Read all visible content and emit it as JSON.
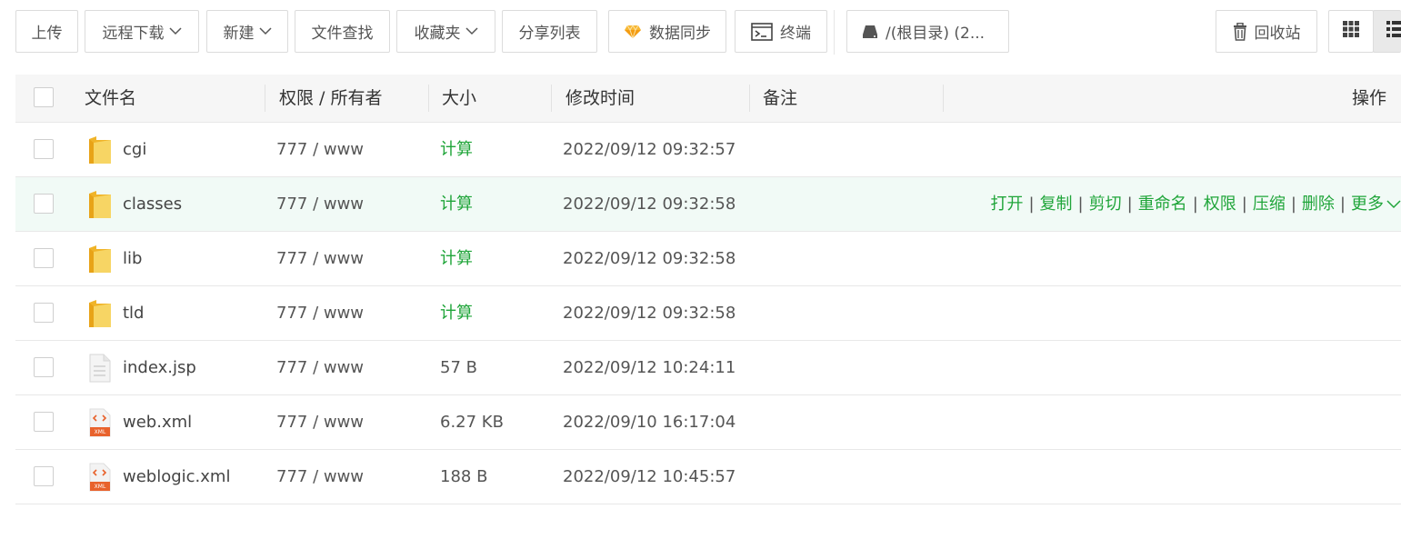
{
  "toolbar": {
    "upload": "上传",
    "remote_download": "远程下载",
    "new": "新建",
    "file_search": "文件查找",
    "favorites": "收藏夹",
    "share_list": "分享列表",
    "data_sync": "数据同步",
    "terminal": "终端",
    "path": "/(根目录) (2...",
    "recycle_bin": "回收站"
  },
  "table": {
    "headers": {
      "name": "文件名",
      "perm": "权限 / 所有者",
      "size": "大小",
      "mtime": "修改时间",
      "remark": "备注",
      "ops": "操作"
    },
    "rows": [
      {
        "name": "cgi",
        "type": "folder-icon",
        "perm": "777 / www",
        "size": "计算",
        "mtime": "2022/09/12 09:32:57"
      },
      {
        "name": "classes",
        "type": "folder-icon",
        "perm": "777 / www",
        "size": "计算",
        "mtime": "2022/09/12 09:32:58"
      },
      {
        "name": "lib",
        "type": "folder-icon",
        "perm": "777 / www",
        "size": "计算",
        "mtime": "2022/09/12 09:32:58"
      },
      {
        "name": "tld",
        "type": "folder-icon",
        "perm": "777 / www",
        "size": "计算",
        "mtime": "2022/09/12 09:32:58"
      },
      {
        "name": "index.jsp",
        "type": "text-file-icon",
        "perm": "777 / www",
        "size": "57 B",
        "mtime": "2022/09/12 10:24:11"
      },
      {
        "name": "web.xml",
        "type": "xml-file-icon",
        "perm": "777 / www",
        "size": "6.27 KB",
        "mtime": "2022/09/10 16:17:04"
      },
      {
        "name": "weblogic.xml",
        "type": "xml-file-icon",
        "perm": "777 / www",
        "size": "188 B",
        "mtime": "2022/09/12 10:45:57"
      }
    ],
    "row_actions": {
      "open": "打开",
      "copy": "复制",
      "cut": "剪切",
      "rename": "重命名",
      "permission": "权限",
      "compress": "压缩",
      "delete": "删除",
      "more": "更多",
      "separator": "|"
    },
    "xml_badge": "XML"
  },
  "colors": {
    "accent_green": "#20a53a",
    "row_hover": "#f1faf6",
    "header_bg": "#f6f6f6",
    "folder_yellow": "#f5c542",
    "xml_orange": "#e8622c"
  }
}
